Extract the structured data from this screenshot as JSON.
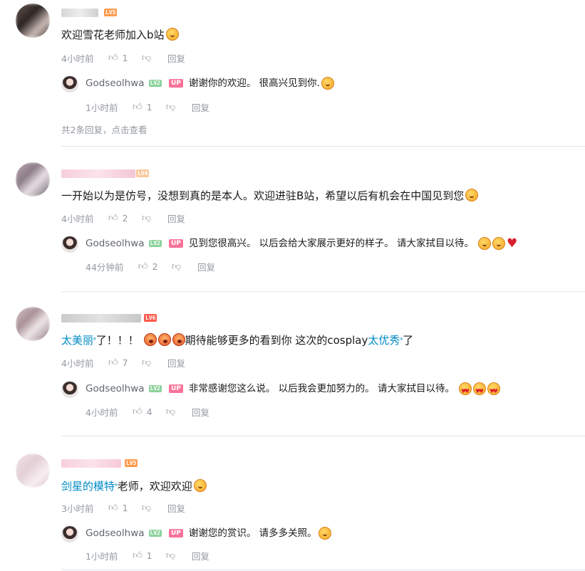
{
  "comments": [
    {
      "level": "LV5",
      "text_parts": [
        "欢迎雪花老师加入b站"
      ],
      "emoji": [
        "surprised-face"
      ],
      "time": "4小时前",
      "likes": "1",
      "reply_label": "回复",
      "reply": {
        "name": "Godseolhwa",
        "level": "LV2",
        "badge": "UP",
        "text": "谢谢你的欢迎。 很高兴见到你.",
        "emoji": [
          "smiling-face"
        ],
        "time": "1小时前",
        "likes": "1",
        "reply_label": "回复"
      },
      "more_replies": "共2条回复，点击查看"
    },
    {
      "level": "LV4",
      "text": "一开始以为是仿号，没想到真的是本人。欢迎进驻B站，希望以后有机会在中国见到您",
      "emoji": [
        "surprised-face"
      ],
      "time": "4小时前",
      "likes": "2",
      "reply_label": "回复",
      "reply": {
        "name": "Godseolhwa",
        "level": "LV2",
        "badge": "UP",
        "text": "见到您很高兴。 以后会给大家展示更好的样子。 请大家拭目以待。",
        "emoji": [
          "smiling-face",
          "smiling-face",
          "red-heart"
        ],
        "time": "44分钟前",
        "likes": "2",
        "reply_label": "回复"
      }
    },
    {
      "level": "LV6",
      "link1": "太美丽",
      "text_mid": "了！！！",
      "text_after": "期待能够更多的看到你 这次的cosplay",
      "link2": "太优秀",
      "text_end": "了",
      "emoji": [
        "crying-face",
        "crying-face",
        "crying-face"
      ],
      "time": "4小时前",
      "likes": "7",
      "reply_label": "回复",
      "reply": {
        "name": "Godseolhwa",
        "level": "LV2",
        "badge": "UP",
        "text": "非常感谢您这么说。 以后我会更加努力的。 请大家拭目以待。",
        "emoji": [
          "heart-eyes-face",
          "heart-eyes-face",
          "heart-eyes-face"
        ],
        "time": "4小时前",
        "likes": "4",
        "reply_label": "回复"
      }
    },
    {
      "level": "LV5",
      "link1": "剑星的模特",
      "text_after": "老师，欢迎欢迎",
      "emoji": [
        "surprised-face"
      ],
      "time": "3小时前",
      "likes": "1",
      "reply_label": "回复",
      "reply": {
        "name": "Godseolhwa",
        "level": "LV2",
        "badge": "UP",
        "text": "谢谢您的赏识。 请多多关照。",
        "emoji": [
          "smiling-face"
        ],
        "time": "1小时前",
        "likes": "1",
        "reply_label": "回复"
      }
    }
  ],
  "icons": {
    "like": "thumbs-up-icon",
    "dislike": "thumbs-down-icon",
    "search": "search-mark-icon"
  },
  "colors": {
    "link": "#008ac5",
    "up_badge": "#fb7299",
    "lv2": "#8bd29b",
    "lv4": "#f9c99d",
    "lv5": "#ff9b4d",
    "lv6": "#ff5a4d",
    "meta": "#9499a0"
  }
}
